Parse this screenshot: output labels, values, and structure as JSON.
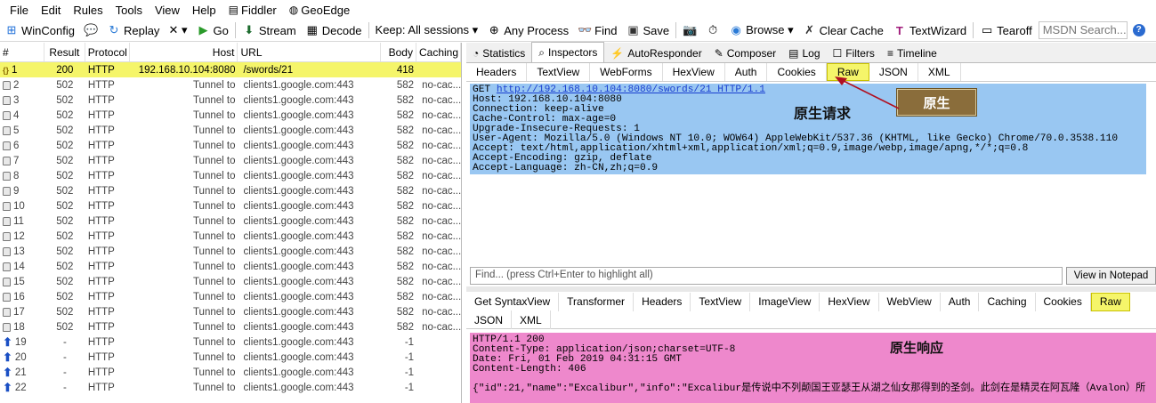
{
  "menu": [
    {
      "label": "File"
    },
    {
      "label": "Edit"
    },
    {
      "label": "Rules"
    },
    {
      "label": "Tools"
    },
    {
      "label": "View"
    },
    {
      "label": "Help"
    },
    {
      "label": "Fiddler",
      "icon": "fiddler-icon"
    },
    {
      "label": "GeoEdge",
      "icon": "geoedge-icon"
    }
  ],
  "toolbar": {
    "winconfig": "WinConfig",
    "replay": "Replay",
    "x": "✕ ▾",
    "go": "Go",
    "stream": "Stream",
    "decode": "Decode",
    "keep": "Keep: All sessions ▾",
    "process": "Any Process",
    "find": "Find",
    "save": "Save",
    "browse": "Browse ▾",
    "clear_cache": "Clear Cache",
    "textwizard": "TextWizard",
    "tearoff": "Tearoff",
    "msdn_placeholder": "MSDN Search..."
  },
  "sessions": {
    "headers": {
      "num": "#",
      "result": "Result",
      "protocol": "Protocol",
      "host": "Host",
      "url": "URL",
      "body": "Body",
      "caching": "Caching"
    },
    "rows": [
      {
        "num": "1",
        "result": "200",
        "protocol": "HTTP",
        "host": "192.168.10.104:8080",
        "url": "/swords/21",
        "body": "418",
        "caching": "",
        "icon": "json-icon"
      },
      {
        "num": "2",
        "result": "502",
        "protocol": "HTTP",
        "host": "Tunnel to",
        "url": "clients1.google.com:443",
        "body": "582",
        "caching": "no-cac...",
        "icon": "lock-icon"
      },
      {
        "num": "3",
        "result": "502",
        "protocol": "HTTP",
        "host": "Tunnel to",
        "url": "clients1.google.com:443",
        "body": "582",
        "caching": "no-cac...",
        "icon": "lock-icon"
      },
      {
        "num": "4",
        "result": "502",
        "protocol": "HTTP",
        "host": "Tunnel to",
        "url": "clients1.google.com:443",
        "body": "582",
        "caching": "no-cac...",
        "icon": "lock-icon"
      },
      {
        "num": "5",
        "result": "502",
        "protocol": "HTTP",
        "host": "Tunnel to",
        "url": "clients1.google.com:443",
        "body": "582",
        "caching": "no-cac...",
        "icon": "lock-icon"
      },
      {
        "num": "6",
        "result": "502",
        "protocol": "HTTP",
        "host": "Tunnel to",
        "url": "clients1.google.com:443",
        "body": "582",
        "caching": "no-cac...",
        "icon": "lock-icon"
      },
      {
        "num": "7",
        "result": "502",
        "protocol": "HTTP",
        "host": "Tunnel to",
        "url": "clients1.google.com:443",
        "body": "582",
        "caching": "no-cac...",
        "icon": "lock-icon"
      },
      {
        "num": "8",
        "result": "502",
        "protocol": "HTTP",
        "host": "Tunnel to",
        "url": "clients1.google.com:443",
        "body": "582",
        "caching": "no-cac...",
        "icon": "lock-icon"
      },
      {
        "num": "9",
        "result": "502",
        "protocol": "HTTP",
        "host": "Tunnel to",
        "url": "clients1.google.com:443",
        "body": "582",
        "caching": "no-cac...",
        "icon": "lock-icon"
      },
      {
        "num": "10",
        "result": "502",
        "protocol": "HTTP",
        "host": "Tunnel to",
        "url": "clients1.google.com:443",
        "body": "582",
        "caching": "no-cac...",
        "icon": "lock-icon"
      },
      {
        "num": "11",
        "result": "502",
        "protocol": "HTTP",
        "host": "Tunnel to",
        "url": "clients1.google.com:443",
        "body": "582",
        "caching": "no-cac...",
        "icon": "lock-icon"
      },
      {
        "num": "12",
        "result": "502",
        "protocol": "HTTP",
        "host": "Tunnel to",
        "url": "clients1.google.com:443",
        "body": "582",
        "caching": "no-cac...",
        "icon": "lock-icon"
      },
      {
        "num": "13",
        "result": "502",
        "protocol": "HTTP",
        "host": "Tunnel to",
        "url": "clients1.google.com:443",
        "body": "582",
        "caching": "no-cac...",
        "icon": "lock-icon"
      },
      {
        "num": "14",
        "result": "502",
        "protocol": "HTTP",
        "host": "Tunnel to",
        "url": "clients1.google.com:443",
        "body": "582",
        "caching": "no-cac...",
        "icon": "lock-icon"
      },
      {
        "num": "15",
        "result": "502",
        "protocol": "HTTP",
        "host": "Tunnel to",
        "url": "clients1.google.com:443",
        "body": "582",
        "caching": "no-cac...",
        "icon": "lock-icon"
      },
      {
        "num": "16",
        "result": "502",
        "protocol": "HTTP",
        "host": "Tunnel to",
        "url": "clients1.google.com:443",
        "body": "582",
        "caching": "no-cac...",
        "icon": "lock-icon"
      },
      {
        "num": "17",
        "result": "502",
        "protocol": "HTTP",
        "host": "Tunnel to",
        "url": "clients1.google.com:443",
        "body": "582",
        "caching": "no-cac...",
        "icon": "lock-icon"
      },
      {
        "num": "18",
        "result": "502",
        "protocol": "HTTP",
        "host": "Tunnel to",
        "url": "clients1.google.com:443",
        "body": "582",
        "caching": "no-cac...",
        "icon": "lock-icon"
      },
      {
        "num": "19",
        "result": "-",
        "protocol": "HTTP",
        "host": "Tunnel to",
        "url": "clients1.google.com:443",
        "body": "-1",
        "caching": "",
        "icon": "up-arrow-icon"
      },
      {
        "num": "20",
        "result": "-",
        "protocol": "HTTP",
        "host": "Tunnel to",
        "url": "clients1.google.com:443",
        "body": "-1",
        "caching": "",
        "icon": "up-arrow-icon"
      },
      {
        "num": "21",
        "result": "-",
        "protocol": "HTTP",
        "host": "Tunnel to",
        "url": "clients1.google.com:443",
        "body": "-1",
        "caching": "",
        "icon": "up-arrow-icon"
      },
      {
        "num": "22",
        "result": "-",
        "protocol": "HTTP",
        "host": "Tunnel to",
        "url": "clients1.google.com:443",
        "body": "-1",
        "caching": "",
        "icon": "up-arrow-icon"
      }
    ]
  },
  "inspector": {
    "top_tabs": [
      {
        "label": "Statistics",
        "icon": "stats-icon"
      },
      {
        "label": "Inspectors",
        "icon": "inspect-icon"
      },
      {
        "label": "AutoResponder",
        "icon": "bolt-icon"
      },
      {
        "label": "Composer",
        "icon": "compose-icon"
      },
      {
        "label": "Log",
        "icon": "log-icon"
      },
      {
        "label": "Filters",
        "icon": "filter-icon"
      },
      {
        "label": "Timeline",
        "icon": "timeline-icon"
      }
    ],
    "request_tabs": [
      "Headers",
      "TextView",
      "WebForms",
      "HexView",
      "Auth",
      "Cookies",
      "Raw",
      "JSON",
      "XML"
    ],
    "request_first_line_method": "GET ",
    "request_first_line_url": "http://192.168.10.104:8080/swords/21 HTTP/1.1",
    "request_body": "Host: 192.168.10.104:8080\nConnection: keep-alive\nCache-Control: max-age=0\nUpgrade-Insecure-Requests: 1\nUser-Agent: Mozilla/5.0 (Windows NT 10.0; WOW64) AppleWebKit/537.36 (KHTML, like Gecko) Chrome/70.0.3538.110\nAccept: text/html,application/xhtml+xml,application/xml;q=0.9,image/webp,image/apng,*/*;q=0.8\nAccept-Encoding: gzip, deflate\nAccept-Language: zh-CN,zh;q=0.9",
    "request_annotation": "原生请求",
    "raw_callout": "原生",
    "find_placeholder": "Find... (press Ctrl+Enter to highlight all)",
    "notepad_button": "View in Notepad",
    "response_tabs_row1": [
      "Get SyntaxView",
      "Transformer",
      "Headers",
      "TextView",
      "ImageView",
      "HexView",
      "WebView",
      "Auth",
      "Caching",
      "Cookies",
      "Raw"
    ],
    "response_tabs_row2": [
      "JSON",
      "XML"
    ],
    "response_body": "HTTP/1.1 200\nContent-Type: application/json;charset=UTF-8\nDate: Fri, 01 Feb 2019 04:31:15 GMT\nContent-Length: 406\n\n{\"id\":21,\"name\":\"Excalibur\",\"info\":\"Excalibur是传说中不列颠国王亚瑟王从湖之仙女那得到的圣剑。此剑在是精灵在阿瓦隆（Avalon）所",
    "response_annotation": "原生响应"
  },
  "colors": {
    "selected_row": "#f5f56a",
    "request_bg": "#99c7f2",
    "response_bg": "#ee88cc",
    "callout_bg": "#8a6d3b",
    "arrow": "#b01020"
  }
}
